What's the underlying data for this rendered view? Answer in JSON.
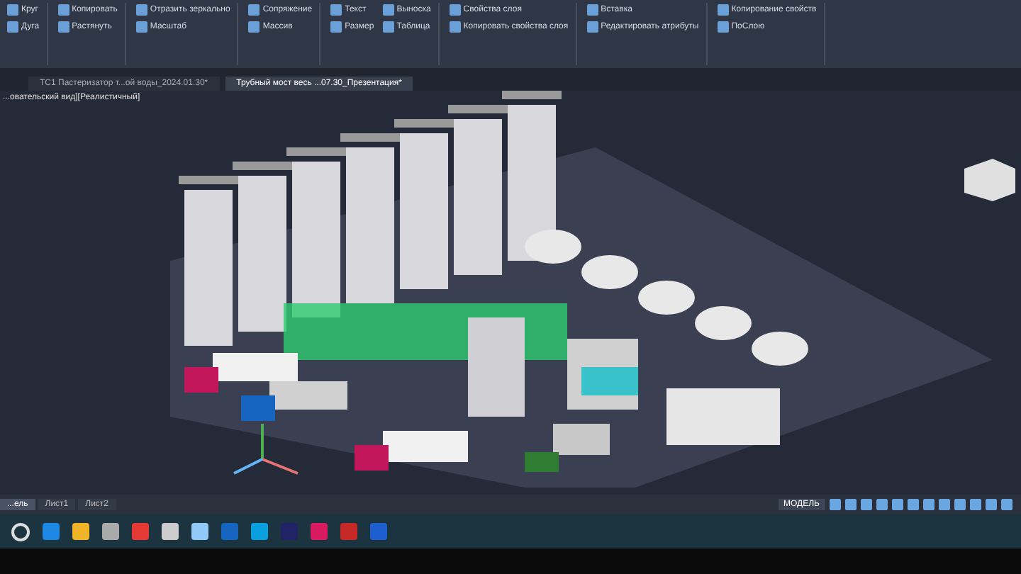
{
  "ribbon": {
    "panels": [
      {
        "items": [
          "Круг",
          "Дуга"
        ]
      },
      {
        "items": [
          "Копировать",
          "Растянуть"
        ]
      },
      {
        "items": [
          "Отразить зеркально",
          "Масштаб"
        ]
      },
      {
        "items": [
          "Сопряжение",
          "Массив"
        ]
      },
      {
        "items": [
          "Текст",
          "Размер",
          "Выноска",
          "Таблица"
        ]
      },
      {
        "items": [
          "Свойства слоя",
          "Копировать свойства слоя"
        ]
      },
      {
        "items": [
          "Вставка",
          "Редактировать атрибуты"
        ]
      },
      {
        "items": [
          "Копирование свойств",
          "ПоСлою"
        ]
      }
    ]
  },
  "file_tabs": [
    {
      "label": "ТС1 Пастеризатор т...ой воды_2024.01.30*",
      "selected": false
    },
    {
      "label": "Трубный мост весь ...07.30_Презентация*",
      "selected": true
    }
  ],
  "viewport": {
    "label": "...овательский вид][Реалистичный]"
  },
  "layout_tabs": [
    {
      "label": "...ель",
      "selected": true
    },
    {
      "label": "Лист1",
      "selected": false
    },
    {
      "label": "Лист2",
      "selected": false
    }
  ],
  "status_bar": {
    "mode": "МОДЕЛЬ"
  }
}
